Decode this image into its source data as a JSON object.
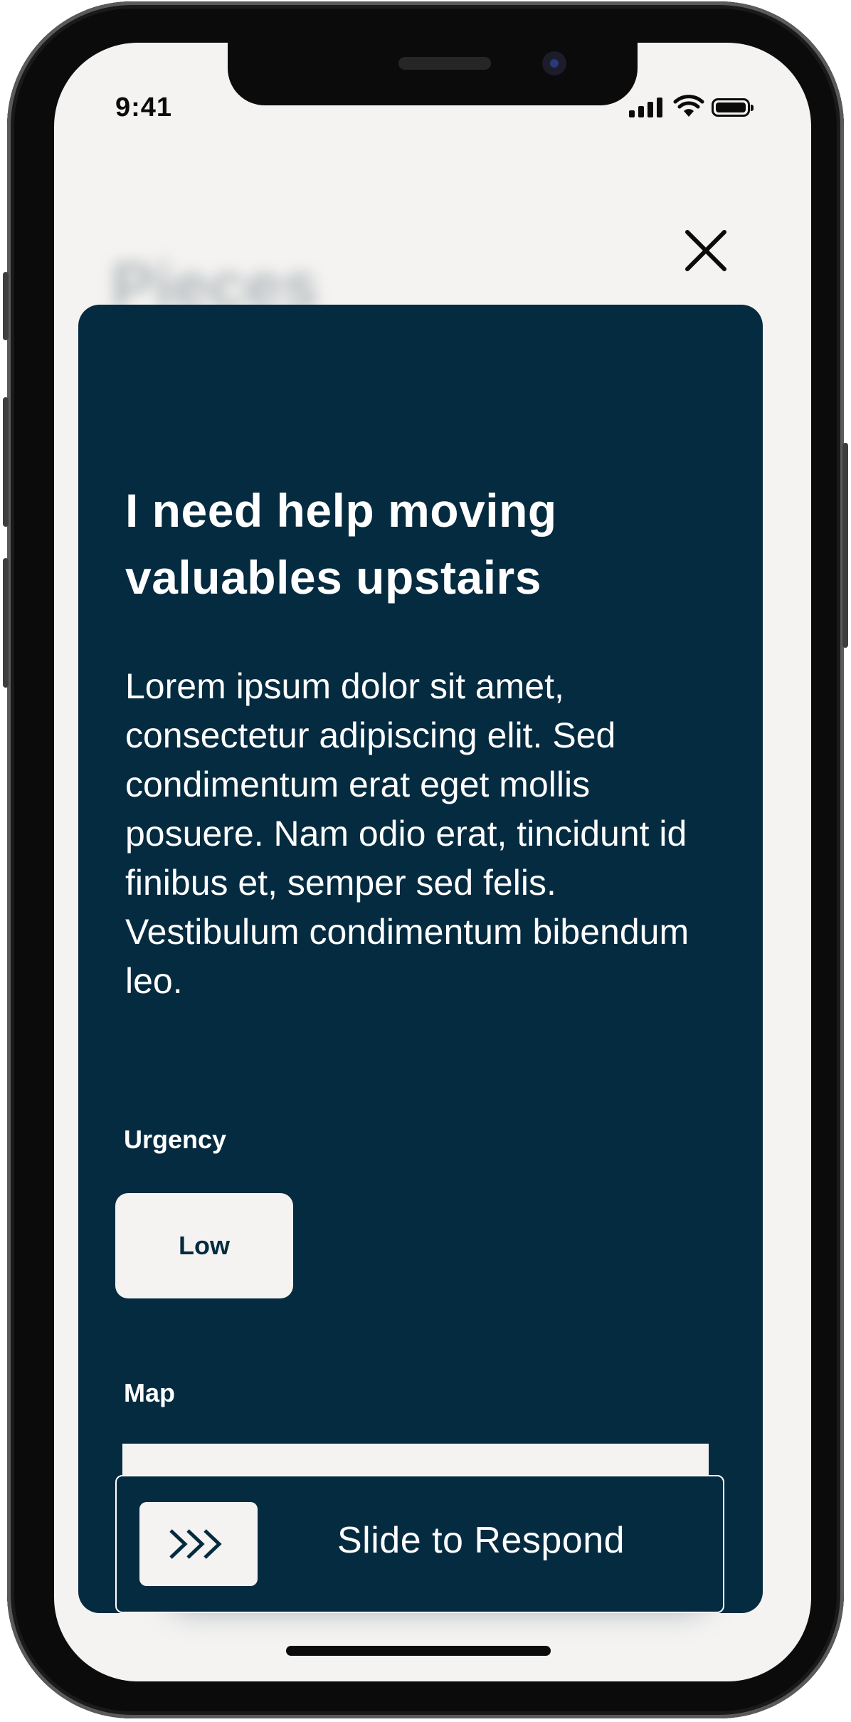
{
  "status_bar": {
    "time": "9:41"
  },
  "background": {
    "title": "Pieces"
  },
  "card": {
    "title": "I need help moving valuables upstairs",
    "body": "Lorem ipsum dolor sit amet, consectetur adipiscing elit. Sed condimentum erat eget mollis posuere. Nam odio erat, tincidunt id finibus et, semper sed felis. Vestibulum condimentum bibendum leo.",
    "urgency_label": "Urgency",
    "urgency_value": "Low",
    "map_label": "Map",
    "slider_label": "Slide to Respond",
    "slider_icon": "triple-chevron-right-icon"
  },
  "colors": {
    "card_background": "#052b40",
    "screen_background": "#f4f3f1",
    "text_light": "#ffffff"
  },
  "icons": {
    "close": "close-icon",
    "slider": "triple-chevron-right-icon"
  }
}
